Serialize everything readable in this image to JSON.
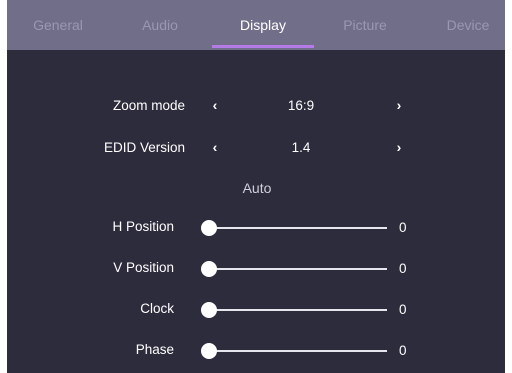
{
  "tabs": [
    {
      "label": "General",
      "active": false
    },
    {
      "label": "Audio",
      "active": false
    },
    {
      "label": "Display",
      "active": true
    },
    {
      "label": "Picture",
      "active": false
    },
    {
      "label": "Device",
      "active": false
    }
  ],
  "settings": {
    "zoom_mode": {
      "label": "Zoom mode",
      "value": "16:9",
      "prev_icon": "chevron-left-icon",
      "next_icon": "chevron-right-icon"
    },
    "edid_version": {
      "label": "EDID Version",
      "value": "1.4",
      "prev_icon": "chevron-left-icon",
      "next_icon": "chevron-right-icon"
    },
    "auto_label": "Auto",
    "sliders": [
      {
        "label": "H Position",
        "value": "0",
        "level": 0
      },
      {
        "label": "V Position",
        "value": "0",
        "level": 0
      },
      {
        "label": "Clock",
        "value": "0",
        "level": 0
      },
      {
        "label": "Phase",
        "value": "0",
        "level": 0
      }
    ]
  },
  "colors": {
    "tabbar_bg": "#716e8a",
    "panel_bg": "#2d2c3c",
    "accent": "#b47ae6",
    "text": "#ffffff",
    "inactive_tab_text": "#9a98b0"
  }
}
